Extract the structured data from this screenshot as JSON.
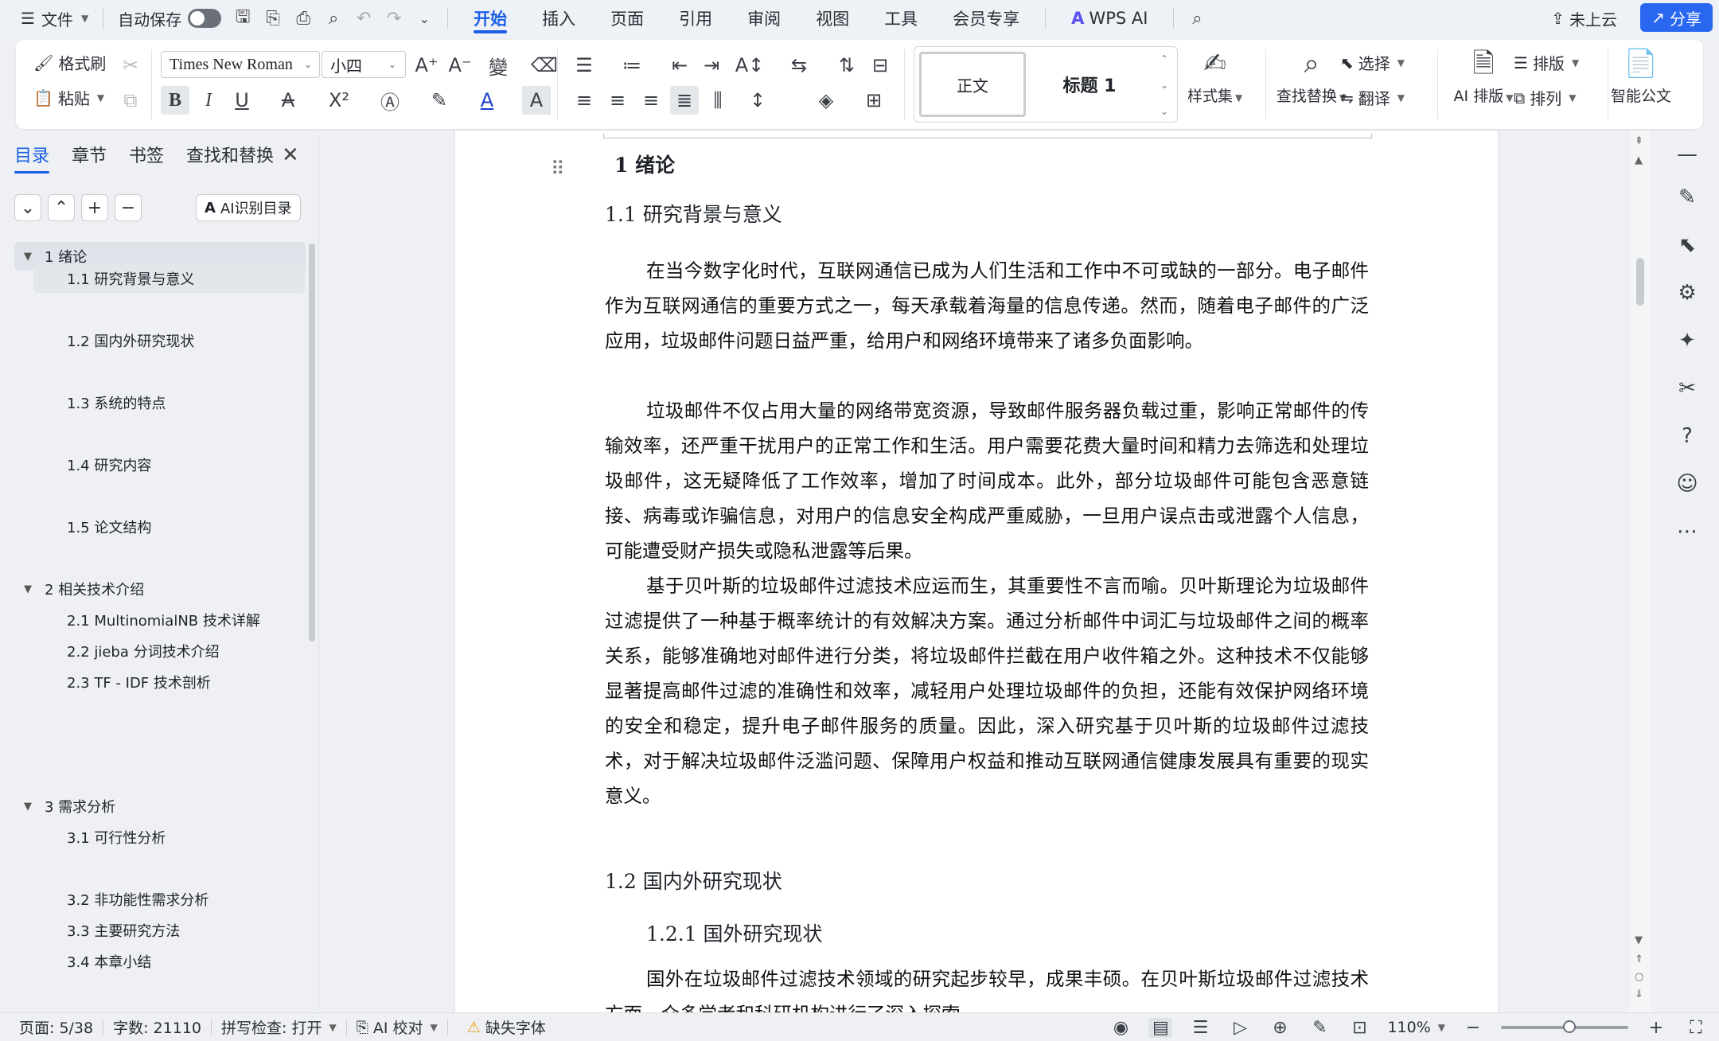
{
  "menubar": {
    "file_label": "文件",
    "autosave_label": "自动保存",
    "tabs": [
      "开始",
      "插入",
      "页面",
      "引用",
      "审阅",
      "视图",
      "工具",
      "会员专享"
    ],
    "wps_ai_label": "WPS AI",
    "cloud_label": "未上云",
    "share_label": "分享"
  },
  "ribbon": {
    "format_painter": "格式刷",
    "paste": "粘贴",
    "font_name": "Times New Roman",
    "font_size": "小四",
    "style_normal": "正文",
    "style_heading1": "标题 1",
    "style_set": "样式集",
    "find_replace": "查找替换",
    "select": "选择",
    "translate": "翻译",
    "ai_layout": "AI 排版",
    "typeset": "排版",
    "arrange": "排列",
    "smart_doc": "智能公文"
  },
  "nav": {
    "tabs": [
      "目录",
      "章节",
      "书签",
      "查找和替换"
    ],
    "ai_toc_label": "AI识别目录",
    "toc": [
      {
        "label": "1  绪论",
        "level": 1
      },
      {
        "label": "1.1 研究背景与意义",
        "level": 2
      },
      {
        "label": "1.2 国内外研究现状",
        "level": 2
      },
      {
        "label": "1.3 系统的特点",
        "level": 2
      },
      {
        "label": "1.4 研究内容",
        "level": 2
      },
      {
        "label": "1.5 论文结构",
        "level": 2
      },
      {
        "label": "2  相关技术介绍",
        "level": 1
      },
      {
        "label": "2.1 MultinomialNB  技术详解",
        "level": 2
      },
      {
        "label": "2.2 jieba  分词技术介绍",
        "level": 2
      },
      {
        "label": "2.3 TF - IDF  技术剖析",
        "level": 2
      },
      {
        "label": "3  需求分析",
        "level": 1
      },
      {
        "label": "3.1 可行性分析",
        "level": 2
      },
      {
        "label": "3.2  非功能性需求分析",
        "level": 2
      },
      {
        "label": "3.3 主要研究方法",
        "level": 2
      },
      {
        "label": "3.4 本章小结",
        "level": 2
      }
    ]
  },
  "document": {
    "h1": "1  绪论",
    "h2_1": "1.1 研究背景与意义",
    "p1": "在当今数字化时代，互联网通信已成为人们生活和工作中不可或缺的一部分。电子邮件作为互联网通信的重要方式之一，每天承载着海量的信息传递。然而，随着电子邮件的广泛应用，垃圾邮件问题日益严重，给用户和网络环境带来了诸多负面影响。",
    "p2": "垃圾邮件不仅占用大量的网络带宽资源，导致邮件服务器负载过重，影响正常邮件的传输效率，还严重干扰用户的正常工作和生活。用户需要花费大量时间和精力去筛选和处理垃圾邮件，这无疑降低了工作效率，增加了时间成本。此外，部分垃圾邮件可能包含恶意链接、病毒或诈骗信息，对用户的信息安全构成严重威胁，一旦用户误点击或泄露个人信息，可能遭受财产损失或隐私泄露等后果。",
    "p3": "基于贝叶斯的垃圾邮件过滤技术应运而生，其重要性不言而喻。贝叶斯理论为垃圾邮件过滤提供了一种基于概率统计的有效解决方案。通过分析邮件中词汇与垃圾邮件之间的概率关系，能够准确地对邮件进行分类，将垃圾邮件拦截在用户收件箱之外。这种技术不仅能够显著提高邮件过滤的准确性和效率，减轻用户处理垃圾邮件的负担，还能有效保护网络环境的安全和稳定，提升电子邮件服务的质量。因此，深入研究基于贝叶斯的垃圾邮件过滤技术，对于解决垃圾邮件泛滥问题、保障用户权益和推动互联网通信健康发展具有重要的现实意义。",
    "h2_2": "1.2 国内外研究现状",
    "h3_1": "1.2.1  国外研究现状",
    "p4": "国外在垃圾邮件过滤技术领域的研究起步较早，成果丰硕。在贝叶斯垃圾邮件过滤技术方面，众多学者和科研机构进行了深入探索。"
  },
  "status": {
    "page": "页面: 5/38",
    "words": "字数: 21110",
    "spell": "拼写检查: 打开",
    "ai_check": "AI 校对",
    "missing_font": "缺失字体",
    "zoom": "110%"
  }
}
